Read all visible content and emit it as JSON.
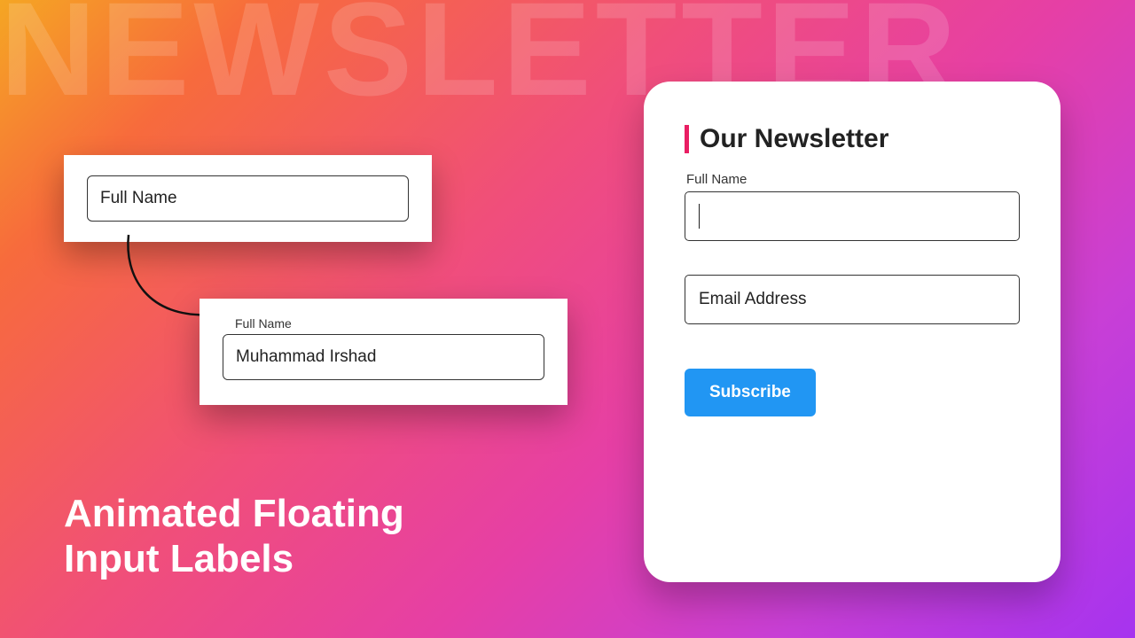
{
  "background_text": "NEWSLETTER",
  "headline": "Animated Floating\nInput Labels",
  "demo": {
    "input1_placeholder": "Full Name",
    "float_label": "Full Name",
    "input2_value": "Muhammad Irshad"
  },
  "newsletter": {
    "title": "Our Newsletter",
    "full_name_label": "Full Name",
    "email_label": "Email Address",
    "subscribe": "Subscribe"
  },
  "colors": {
    "accent": "#e91e63",
    "button": "#2196f3"
  }
}
